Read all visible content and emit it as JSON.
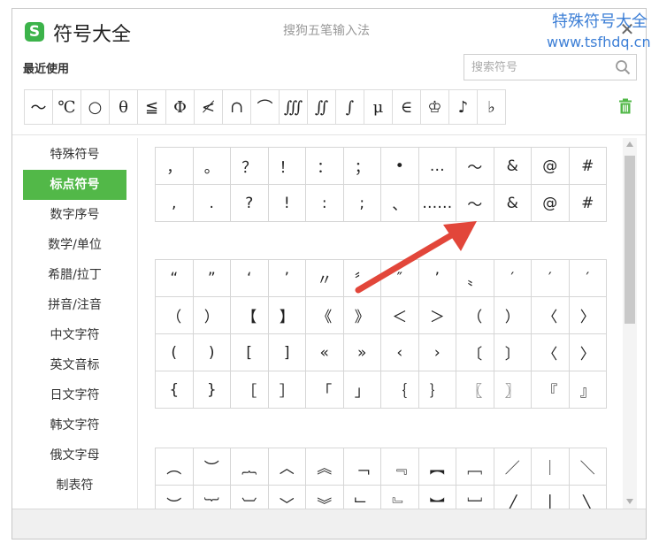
{
  "app": {
    "title": "符号大全",
    "logo_letter": "S",
    "ime_name": "搜狗五笔输入法",
    "close_symbol": "✕"
  },
  "watermark": {
    "line1": "特殊符号大全",
    "line2": "www.tsfhdq.cn"
  },
  "recent": {
    "label": "最近使用",
    "symbols": [
      "～",
      "℃",
      "○",
      "θ",
      "≦",
      "Φ",
      "≮",
      "∩",
      "⌒",
      "∭",
      "∬",
      "∫",
      "μ",
      "∈",
      "♔",
      "♪",
      "♭"
    ]
  },
  "search": {
    "placeholder": "搜索符号",
    "value": ""
  },
  "sidebar": {
    "items": [
      {
        "label": "特殊符号"
      },
      {
        "label": "标点符号",
        "active": true
      },
      {
        "label": "数字序号"
      },
      {
        "label": "数学/单位"
      },
      {
        "label": "希腊/拉丁"
      },
      {
        "label": "拼音/注音"
      },
      {
        "label": "中文字符"
      },
      {
        "label": "英文音标"
      },
      {
        "label": "日文字符"
      },
      {
        "label": "韩文字符"
      },
      {
        "label": "俄文字母"
      },
      {
        "label": "制表符"
      }
    ]
  },
  "groups": [
    {
      "symbols": [
        "，",
        "。",
        "？",
        "！",
        "：",
        "；",
        "•",
        "…",
        "～",
        "&",
        "@",
        "#",
        ",",
        ".",
        "?",
        "!",
        ":",
        ";",
        "、",
        "……",
        "〜",
        "&",
        "@",
        "#"
      ]
    },
    {
      "symbols": [
        "“",
        "”",
        "‘",
        "’",
        "〃",
        "〞",
        "″",
        "’",
        "〟",
        "′",
        "′",
        "′",
        "（",
        "）",
        "【",
        "】",
        "《",
        "》",
        "＜",
        "＞",
        "（",
        "）",
        "〈",
        "〉",
        "(",
        ")",
        "[",
        "]",
        "«",
        "»",
        "‹",
        "›",
        "〔",
        "〕",
        "〈",
        "〉",
        "{",
        "}",
        "［",
        "］",
        "「",
        "」",
        "｛",
        "｝",
        "〖",
        "〗",
        "『",
        "』"
      ]
    },
    {
      "symbols": [
        "︵",
        "︶",
        "︷",
        "︿",
        "︽",
        "﹁",
        "﹃",
        "︻",
        "﹇",
        "／",
        "｜",
        "＼",
        "︶",
        "︸",
        "︺",
        "﹀",
        "︾",
        "﹂",
        "﹄",
        "︼",
        "﹈",
        "╱",
        "│",
        "╲"
      ]
    }
  ],
  "colors": {
    "accent": "#52b848",
    "arrow": "#e2463a",
    "watermark": "#3d7fd6"
  },
  "icons": {
    "search": "search-icon",
    "trash": "trash-icon",
    "close": "close-icon",
    "logo": "sogou-logo-icon"
  }
}
